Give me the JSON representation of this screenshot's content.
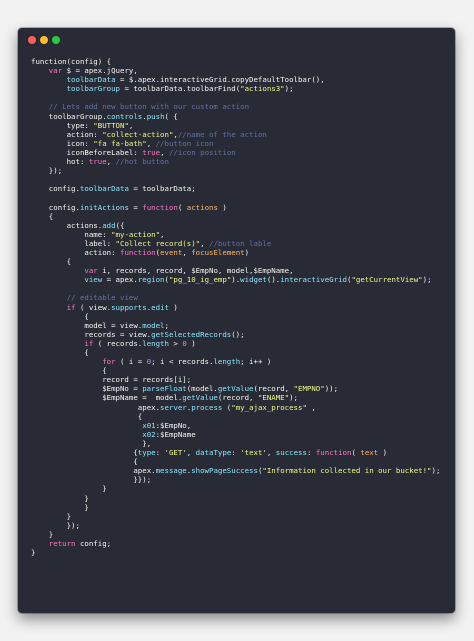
{
  "window": {
    "buttons": [
      {
        "name": "close",
        "color": "#ff5f56"
      },
      {
        "name": "minimize",
        "color": "#ffbd2e"
      },
      {
        "name": "maximize",
        "color": "#27c93f"
      }
    ]
  },
  "theme": {
    "background": "#282a36",
    "text": "#f8f8f2",
    "keyword": "#ff79c6",
    "string": "#f1fa8c",
    "comment": "#6272a4",
    "property": "#8be9fd",
    "param": "#ffb86c",
    "number": "#bd93f9"
  },
  "code": {
    "lines": [
      {
        "indent": 0,
        "tokens": [
          [
            "text",
            "function(config) {"
          ]
        ]
      },
      {
        "indent": 4,
        "tokens": [
          [
            "keyword",
            "var"
          ],
          [
            "text",
            " $ = apex.jQuery,"
          ]
        ]
      },
      {
        "indent": 8,
        "tokens": [
          [
            "prop",
            "toolbarData"
          ],
          [
            "text",
            " = $.apex.interactiveGrid.copyDefaultToolbar(),"
          ]
        ]
      },
      {
        "indent": 8,
        "tokens": [
          [
            "prop",
            "toolbarGroup"
          ],
          [
            "text",
            " = toolbarData.toolbarFind("
          ],
          [
            "string",
            "\"actions3\""
          ],
          [
            "text",
            ");"
          ]
        ]
      },
      {
        "indent": 0,
        "tokens": []
      },
      {
        "indent": 4,
        "tokens": [
          [
            "comment",
            "// Lets add new button with our custom action"
          ]
        ]
      },
      {
        "indent": 4,
        "tokens": [
          [
            "text",
            "toolbarGroup."
          ],
          [
            "prop",
            "controls"
          ],
          [
            "text",
            "."
          ],
          [
            "prop",
            "push"
          ],
          [
            "text",
            "( {"
          ]
        ]
      },
      {
        "indent": 8,
        "tokens": [
          [
            "text",
            "type: "
          ],
          [
            "string",
            "\"BUTTON\""
          ],
          [
            "text",
            ","
          ]
        ]
      },
      {
        "indent": 8,
        "tokens": [
          [
            "text",
            "action: "
          ],
          [
            "string",
            "\"collect-action\""
          ],
          [
            "text",
            ","
          ],
          [
            "comment",
            "//name of the action"
          ]
        ]
      },
      {
        "indent": 8,
        "tokens": [
          [
            "text",
            "icon: "
          ],
          [
            "string",
            "\"fa fa-bath\""
          ],
          [
            "text",
            ", "
          ],
          [
            "comment",
            "//button icon"
          ]
        ]
      },
      {
        "indent": 8,
        "tokens": [
          [
            "text",
            "iconBeforeLabel: "
          ],
          [
            "keyword",
            "true"
          ],
          [
            "text",
            ", "
          ],
          [
            "comment",
            "//icon position"
          ]
        ]
      },
      {
        "indent": 8,
        "tokens": [
          [
            "text",
            "hot: "
          ],
          [
            "keyword",
            "true"
          ],
          [
            "text",
            ", "
          ],
          [
            "comment",
            "//hot button"
          ]
        ]
      },
      {
        "indent": 4,
        "tokens": [
          [
            "text",
            "});"
          ]
        ]
      },
      {
        "indent": 0,
        "tokens": []
      },
      {
        "indent": 4,
        "tokens": [
          [
            "text",
            "config."
          ],
          [
            "prop",
            "toolbarData"
          ],
          [
            "text",
            " = toolbarData;"
          ]
        ]
      },
      {
        "indent": 0,
        "tokens": []
      },
      {
        "indent": 4,
        "tokens": [
          [
            "text",
            "config."
          ],
          [
            "prop",
            "initActions"
          ],
          [
            "text",
            " = "
          ],
          [
            "keyword",
            "function"
          ],
          [
            "text",
            "( "
          ],
          [
            "param",
            "actions"
          ],
          [
            "text",
            " )"
          ]
        ]
      },
      {
        "indent": 4,
        "tokens": [
          [
            "text",
            "{"
          ]
        ]
      },
      {
        "indent": 8,
        "tokens": [
          [
            "text",
            "actions."
          ],
          [
            "prop",
            "add"
          ],
          [
            "text",
            "({"
          ]
        ]
      },
      {
        "indent": 12,
        "tokens": [
          [
            "text",
            "name: "
          ],
          [
            "string",
            "\"my-action\""
          ],
          [
            "text",
            ","
          ]
        ]
      },
      {
        "indent": 12,
        "tokens": [
          [
            "text",
            "label: "
          ],
          [
            "string",
            "\"Collect record(s)\""
          ],
          [
            "text",
            ", "
          ],
          [
            "comment",
            "//button lable"
          ]
        ]
      },
      {
        "indent": 12,
        "tokens": [
          [
            "text",
            "action: "
          ],
          [
            "keyword",
            "function"
          ],
          [
            "text",
            "("
          ],
          [
            "param",
            "event"
          ],
          [
            "text",
            ", "
          ],
          [
            "param",
            "focusElement"
          ],
          [
            "text",
            ")"
          ]
        ]
      },
      {
        "indent": 8,
        "tokens": [
          [
            "text",
            "{"
          ]
        ]
      },
      {
        "indent": 12,
        "tokens": [
          [
            "keyword",
            "var"
          ],
          [
            "text",
            " i, records, record, $EmpNo, model,$EmpName,"
          ]
        ]
      },
      {
        "indent": 12,
        "tokens": [
          [
            "prop",
            "view"
          ],
          [
            "text",
            " = apex."
          ],
          [
            "prop",
            "region"
          ],
          [
            "text",
            "("
          ],
          [
            "string",
            "\"pg_10_ig_emp\""
          ],
          [
            "text",
            ")."
          ],
          [
            "prop",
            "widget"
          ],
          [
            "text",
            "()."
          ],
          [
            "prop",
            "interactiveGrid"
          ],
          [
            "text",
            "("
          ],
          [
            "string",
            "\"getCurrentView\""
          ],
          [
            "text",
            ");"
          ]
        ]
      },
      {
        "indent": 0,
        "tokens": []
      },
      {
        "indent": 8,
        "tokens": [
          [
            "comment",
            "// editable view"
          ]
        ]
      },
      {
        "indent": 8,
        "tokens": [
          [
            "keyword",
            "if"
          ],
          [
            "text",
            " ( view."
          ],
          [
            "prop",
            "supports"
          ],
          [
            "text",
            "."
          ],
          [
            "prop",
            "edit"
          ],
          [
            "text",
            " )"
          ]
        ]
      },
      {
        "indent": 12,
        "tokens": [
          [
            "text",
            "{"
          ]
        ]
      },
      {
        "indent": 12,
        "tokens": [
          [
            "text",
            "model = view."
          ],
          [
            "prop",
            "model"
          ],
          [
            "text",
            ";"
          ]
        ]
      },
      {
        "indent": 12,
        "tokens": [
          [
            "text",
            "records = view."
          ],
          [
            "prop",
            "getSelectedRecords"
          ],
          [
            "text",
            "();"
          ]
        ]
      },
      {
        "indent": 12,
        "tokens": [
          [
            "keyword",
            "if"
          ],
          [
            "text",
            " ( records."
          ],
          [
            "prop",
            "length"
          ],
          [
            "text",
            " > "
          ],
          [
            "num",
            "0"
          ],
          [
            "text",
            " )"
          ]
        ]
      },
      {
        "indent": 12,
        "tokens": [
          [
            "text",
            "{"
          ]
        ]
      },
      {
        "indent": 16,
        "tokens": [
          [
            "keyword",
            "for"
          ],
          [
            "text",
            " ( i = "
          ],
          [
            "num",
            "0"
          ],
          [
            "text",
            "; i < records."
          ],
          [
            "prop",
            "length"
          ],
          [
            "text",
            "; i++ )"
          ]
        ]
      },
      {
        "indent": 16,
        "tokens": [
          [
            "text",
            "{"
          ]
        ]
      },
      {
        "indent": 16,
        "tokens": [
          [
            "text",
            "record = records[i];"
          ]
        ]
      },
      {
        "indent": 16,
        "tokens": [
          [
            "text",
            "$EmpNo = "
          ],
          [
            "prop",
            "parseFloat"
          ],
          [
            "text",
            "(model."
          ],
          [
            "prop",
            "getValue"
          ],
          [
            "text",
            "(record, "
          ],
          [
            "string",
            "\"EMPNO\""
          ],
          [
            "text",
            "));"
          ]
        ]
      },
      {
        "indent": 16,
        "tokens": [
          [
            "text",
            "$EmpName =  model."
          ],
          [
            "prop",
            "getValue"
          ],
          [
            "text",
            "(record, "
          ],
          [
            "string",
            "\"ENAME\""
          ],
          [
            "text",
            ");"
          ]
        ]
      },
      {
        "indent": 24,
        "tokens": [
          [
            "text",
            "apex."
          ],
          [
            "prop",
            "server"
          ],
          [
            "text",
            "."
          ],
          [
            "prop",
            "process"
          ],
          [
            "text",
            " ("
          ],
          [
            "string",
            "\"my_ajax_process\""
          ],
          [
            "text",
            " ,"
          ]
        ]
      },
      {
        "indent": 24,
        "tokens": [
          [
            "text",
            "{"
          ]
        ]
      },
      {
        "indent": 25,
        "tokens": [
          [
            "prop",
            "x01"
          ],
          [
            "text",
            ":$EmpNo,"
          ]
        ]
      },
      {
        "indent": 25,
        "tokens": [
          [
            "prop",
            "x02"
          ],
          [
            "text",
            ":$EmpName"
          ]
        ]
      },
      {
        "indent": 25,
        "tokens": [
          [
            "text",
            "},"
          ]
        ]
      },
      {
        "indent": 23,
        "tokens": [
          [
            "text",
            "{"
          ],
          [
            "prop",
            "type"
          ],
          [
            "text",
            ": "
          ],
          [
            "string",
            "'GET'"
          ],
          [
            "text",
            ", "
          ],
          [
            "prop",
            "dataType"
          ],
          [
            "text",
            ": "
          ],
          [
            "string",
            "'text'"
          ],
          [
            "text",
            ", "
          ],
          [
            "prop",
            "success"
          ],
          [
            "text",
            ": "
          ],
          [
            "keyword",
            "function"
          ],
          [
            "text",
            "( "
          ],
          [
            "param",
            "text"
          ],
          [
            "text",
            " )"
          ]
        ]
      },
      {
        "indent": 23,
        "tokens": [
          [
            "text",
            "{"
          ]
        ]
      },
      {
        "indent": 23,
        "tokens": [
          [
            "text",
            "apex."
          ],
          [
            "prop",
            "message"
          ],
          [
            "text",
            "."
          ],
          [
            "prop",
            "showPageSuccess"
          ],
          [
            "text",
            "("
          ],
          [
            "string",
            "\"Information collected in our bucket!\""
          ],
          [
            "text",
            ");"
          ]
        ]
      },
      {
        "indent": 23,
        "tokens": [
          [
            "text",
            "}});"
          ]
        ]
      },
      {
        "indent": 16,
        "tokens": [
          [
            "text",
            "}"
          ]
        ]
      },
      {
        "indent": 12,
        "tokens": [
          [
            "text",
            "}"
          ]
        ]
      },
      {
        "indent": 12,
        "tokens": [
          [
            "text",
            "}"
          ]
        ]
      },
      {
        "indent": 8,
        "tokens": [
          [
            "text",
            "}"
          ]
        ]
      },
      {
        "indent": 8,
        "tokens": [
          [
            "text",
            "});"
          ]
        ]
      },
      {
        "indent": 4,
        "tokens": [
          [
            "text",
            "}"
          ]
        ]
      },
      {
        "indent": 4,
        "tokens": [
          [
            "keyword",
            "return"
          ],
          [
            "text",
            " config;"
          ]
        ]
      },
      {
        "indent": 0,
        "tokens": [
          [
            "text",
            "}"
          ]
        ]
      }
    ]
  }
}
